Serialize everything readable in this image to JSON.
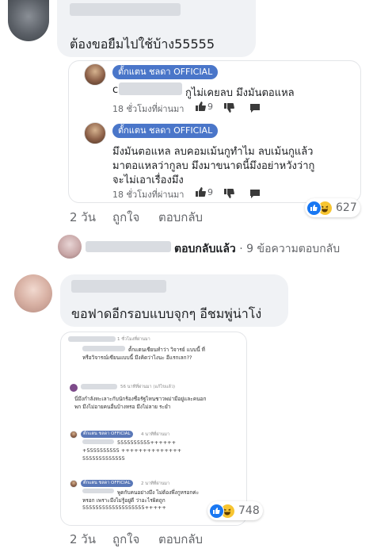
{
  "comment1": {
    "text": "ต้องขอยืมไปใช้บ้าง55555",
    "embedded": {
      "reply1": {
        "tag": "ตั้กแตน ชลดา OFFICIAL",
        "prefix": "c",
        "text": "กูไม่เคยลบ มึงมันตอแหล",
        "time": "18 ชั่วโมงที่ผ่านมา",
        "likes": "9"
      },
      "reply2": {
        "tag": "ตั้กแตน ชลดา OFFICIAL",
        "lines": [
          "มึงมันตอแหล ลบคอมเม้นกูทำไม ลบเม้นกูแล้ว",
          "มาตอแหลว่ากูลบ มึงมาขนาดนี้มึงอย่าหวังว่ากู",
          "จะไม่เอาเรื่องมึง"
        ],
        "time": "18 ชั่วโมงที่ผ่านมา",
        "likes": "9"
      }
    },
    "actions": {
      "time": "2 วัน",
      "like": "ถูกใจ",
      "reply": "ตอบกลับ"
    },
    "reactions": {
      "count": "627",
      "types": [
        "like-icon",
        "haha-icon"
      ]
    }
  },
  "reply_summary": {
    "label": "ตอบกลับแล้ว",
    "separator": "·",
    "count_text": "9 ข้อความตอบกลับ"
  },
  "comment2": {
    "text": "ขอฟาดอีกรอบแบบจุกๆ อีชมพู่น่าโง่",
    "embedded": {
      "c1": {
        "time": "1 ชั่วโมงที่ผ่านมา",
        "lines": [
          "ตั้กแตนเซียนทำว่า วิจารย์ แบบนี้ ที่",
          "หรือวิจารณ์เซียนแบบนี้ มึงคิดว่าไงนะ อีแรกเลก??"
        ]
      },
      "c2": {
        "time": "56 นาทีที่ผ่านมา (แก้ไขแล้ว)",
        "lines": [
          "นี่มึงกำลังทะเลาะกับนักร้องชื่อรัฐไหนชาวพม่ามีอยู่และคนอก",
          "พก มึงไม่อายคนอื่นบ้างหรอ มึงไม่ลาย ระยำ"
        ]
      },
      "c3": {
        "tag": "ตั้กแตน ชลดา OFFICIAL",
        "time": "4 นาทีที่ผ่านมา",
        "lines": [
          "5555555555++++++",
          "+5555555555 ++++++++++++++",
          "5555555555555"
        ]
      },
      "c4": {
        "tag": "ตั้กแตน ชลดา OFFICIAL",
        "time": "2 นาทีที่ผ่านมา",
        "lines": [
          "พูดกับคนอย่างมึง ไม่ต้องพึ่งกูหรอกค่ะ",
          "หรอก เพราะมึงไม่รู้อยู่ดี ว่าอะไรผิดถูก",
          "5555555555555555555+++++"
        ]
      }
    },
    "actions": {
      "time": "2 วัน",
      "like": "ถูกใจ",
      "reply": "ตอบกลับ"
    },
    "reactions": {
      "count": "748",
      "types": [
        "like-icon",
        "haha-icon"
      ]
    }
  },
  "colors": {
    "bubble": "#f0f2f5",
    "tag": "#4a76c9",
    "like": "#1877f2",
    "haha": "#f7c531",
    "meta": "#65676b"
  }
}
